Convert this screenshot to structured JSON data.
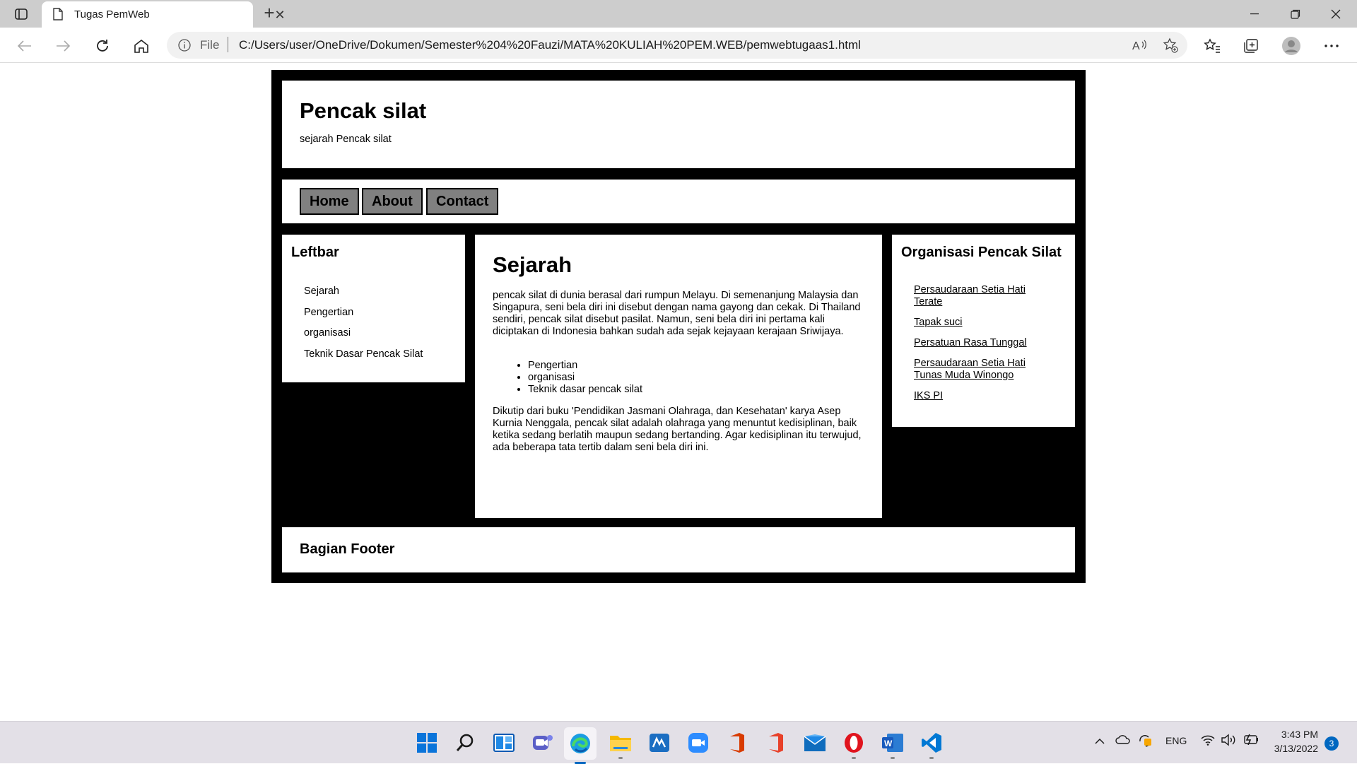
{
  "browser": {
    "tab_title": "Tugas PemWeb",
    "url_scheme_label": "File",
    "url": "C:/Users/user/OneDrive/Dokumen/Semester%204%20Fauzi/MATA%20KULIAH%20PEM.WEB/pemwebtugaas1.html"
  },
  "page": {
    "header": {
      "title": "Pencak silat",
      "subtitle": "sejarah Pencak silat"
    },
    "nav": {
      "items": [
        "Home",
        "About",
        "Contact"
      ]
    },
    "leftbar": {
      "heading": "Leftbar",
      "items": [
        "Sejarah",
        "Pengertian",
        "organisasi",
        "Teknik Dasar Pencak Silat"
      ]
    },
    "main": {
      "heading": "Sejarah",
      "paragraph1": "pencak silat di dunia berasal dari rumpun Melayu. Di semenanjung Malaysia dan Singapura, seni bela diri ini disebut dengan nama gayong dan cekak. Di Thailand sendiri, pencak silat disebut pasilat. Namun, seni bela diri ini pertama kali diciptakan di Indonesia bahkan sudah ada sejak kejayaan kerajaan Sriwijaya.",
      "list": [
        "Pengertian",
        "organisasi",
        "Teknik dasar pencak silat"
      ],
      "paragraph2": "Dikutip dari buku 'Pendidikan Jasmani Olahraga, dan Kesehatan' karya Asep Kurnia Nenggala, pencak silat adalah olahraga yang menuntut kedisiplinan, baik ketika sedang berlatih maupun sedang bertanding. Agar kedisiplinan itu terwujud, ada beberapa tata tertib dalam seni bela diri ini."
    },
    "rightbar": {
      "heading": "Organisasi Pencak Silat",
      "links": [
        "Persaudaraan Setia Hati Terate",
        "Tapak suci",
        "Persatuan Rasa Tunggal",
        "Persaudaraan Setia Hati Tunas Muda Winongo",
        "IKS PI"
      ]
    },
    "footer": {
      "heading": "Bagian Footer"
    }
  },
  "taskbar": {
    "language": "ENG",
    "time": "3:43 PM",
    "date": "3/13/2022",
    "notification_count": "3",
    "apps": [
      "start-icon",
      "search-icon",
      "widgets-icon",
      "teams-icon",
      "edge-icon",
      "file-explorer-icon",
      "whiteboard-icon",
      "zoom-icon",
      "office-icon",
      "office-icon-2",
      "mail-icon",
      "opera-icon",
      "word-icon",
      "vscode-icon"
    ]
  },
  "colors": {
    "nav_button_bg": "#808080",
    "container_bg": "#000000",
    "accent": "#0067c0"
  }
}
